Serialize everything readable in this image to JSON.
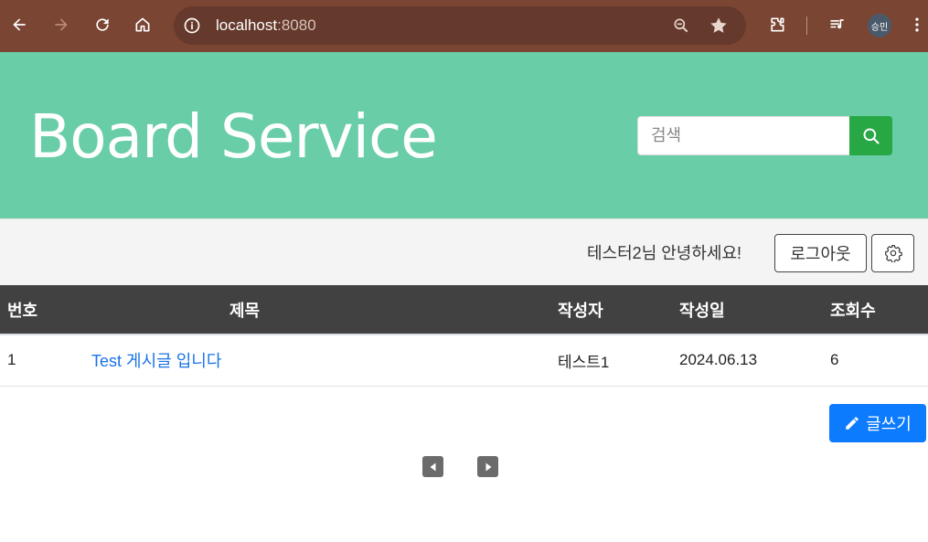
{
  "browser": {
    "url_host": "localhost",
    "url_port": ":8080",
    "profile_initials": "승민",
    "icons": [
      "back-icon",
      "forward-icon",
      "reload-icon",
      "home-icon",
      "site-info-icon",
      "zoom-icon",
      "bookmark-star-icon",
      "extensions-icon",
      "media-icon",
      "more-icon"
    ]
  },
  "header": {
    "title": "Board Service",
    "search_placeholder": "검색",
    "search_icon": "search-icon",
    "bg_color": "#69cda8",
    "search_button_color": "#28a745"
  },
  "user_bar": {
    "greeting": "테스터2님 안녕하세요!",
    "logout_label": "로그아웃",
    "settings_icon": "gear-icon"
  },
  "table": {
    "headers": {
      "no": "번호",
      "title": "제목",
      "author": "작성자",
      "date": "작성일",
      "views": "조회수"
    },
    "rows": [
      {
        "no": "1",
        "title": "Test 게시글 입니다",
        "author": "테스트1",
        "date": "2024.06.13",
        "views": "6"
      }
    ],
    "header_bg": "#414141"
  },
  "actions": {
    "write_label": "글쓰기",
    "write_icon": "pencil-icon",
    "write_color": "#0d7bfd"
  },
  "pagination": {
    "prev_icon": "caret-left-icon",
    "next_icon": "caret-right-icon"
  }
}
